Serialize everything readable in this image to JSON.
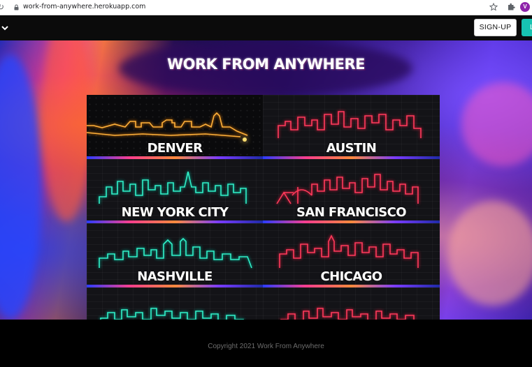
{
  "browser": {
    "url": "work-from-anywhere.herokuapp.com",
    "avatar_letter": "V"
  },
  "nav": {
    "signup_label": "SIGN-UP",
    "login_label": "L"
  },
  "hero": {
    "title": "WORK FROM ANYWHERE"
  },
  "cities": [
    {
      "label": "DENVER",
      "color": "#ffb13b"
    },
    {
      "label": "AUSTIN",
      "color": "#ff3b5c"
    },
    {
      "label": "NEW YORK CITY",
      "color": "#31f0c8"
    },
    {
      "label": "SAN FRANCISCO",
      "color": "#ff3b5c"
    },
    {
      "label": "NASHVILLE",
      "color": "#31f0c8"
    },
    {
      "label": "CHICAGO",
      "color": "#ff3b5c"
    },
    {
      "label": "",
      "color": "#31f0c8"
    },
    {
      "label": "",
      "color": "#ff3b5c"
    }
  ],
  "footer": {
    "copyright": "Copyright 2021 Work From Anywhere"
  },
  "colors": {
    "accent": "#17c3b2",
    "avatar": "#8e24aa"
  }
}
